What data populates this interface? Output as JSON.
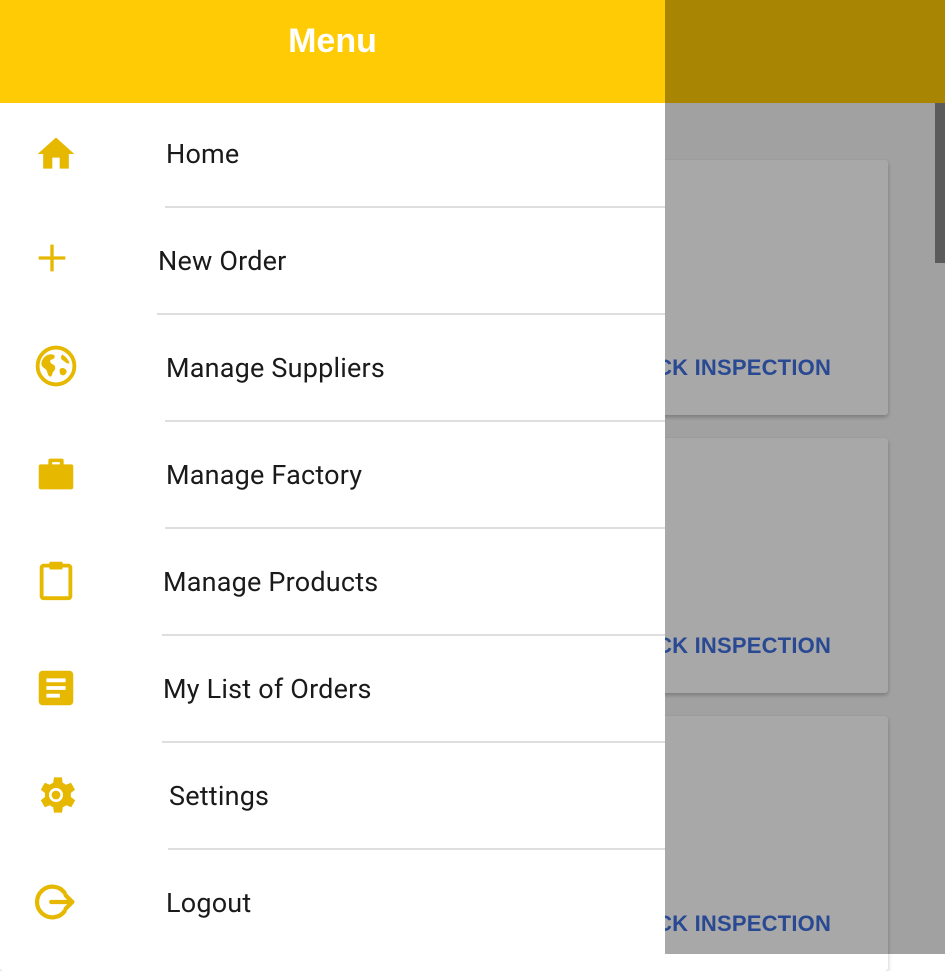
{
  "colors": {
    "accent": "#FFCB05",
    "icon": "#E6B800",
    "link": "#3F6FE0",
    "text": "#1a1a1a",
    "divider": "#dedede"
  },
  "drawer": {
    "title": "Menu",
    "items": [
      {
        "label": "Home",
        "icon": "home-icon"
      },
      {
        "label": "New Order",
        "icon": "plus-icon"
      },
      {
        "label": "Manage Suppliers",
        "icon": "globe-icon"
      },
      {
        "label": "Manage Factory",
        "icon": "briefcase-icon"
      },
      {
        "label": "Manage Products",
        "icon": "clipboard-icon"
      },
      {
        "label": "My List of Orders",
        "icon": "document-icon"
      },
      {
        "label": "Settings",
        "icon": "gear-icon"
      },
      {
        "label": "Logout",
        "icon": "logout-icon"
      }
    ]
  },
  "background": {
    "cards": [
      {
        "action_label": "ACK INSPECTION"
      },
      {
        "action_label": "ACK INSPECTION"
      },
      {
        "action_label": "ACK INSPECTION"
      }
    ]
  }
}
